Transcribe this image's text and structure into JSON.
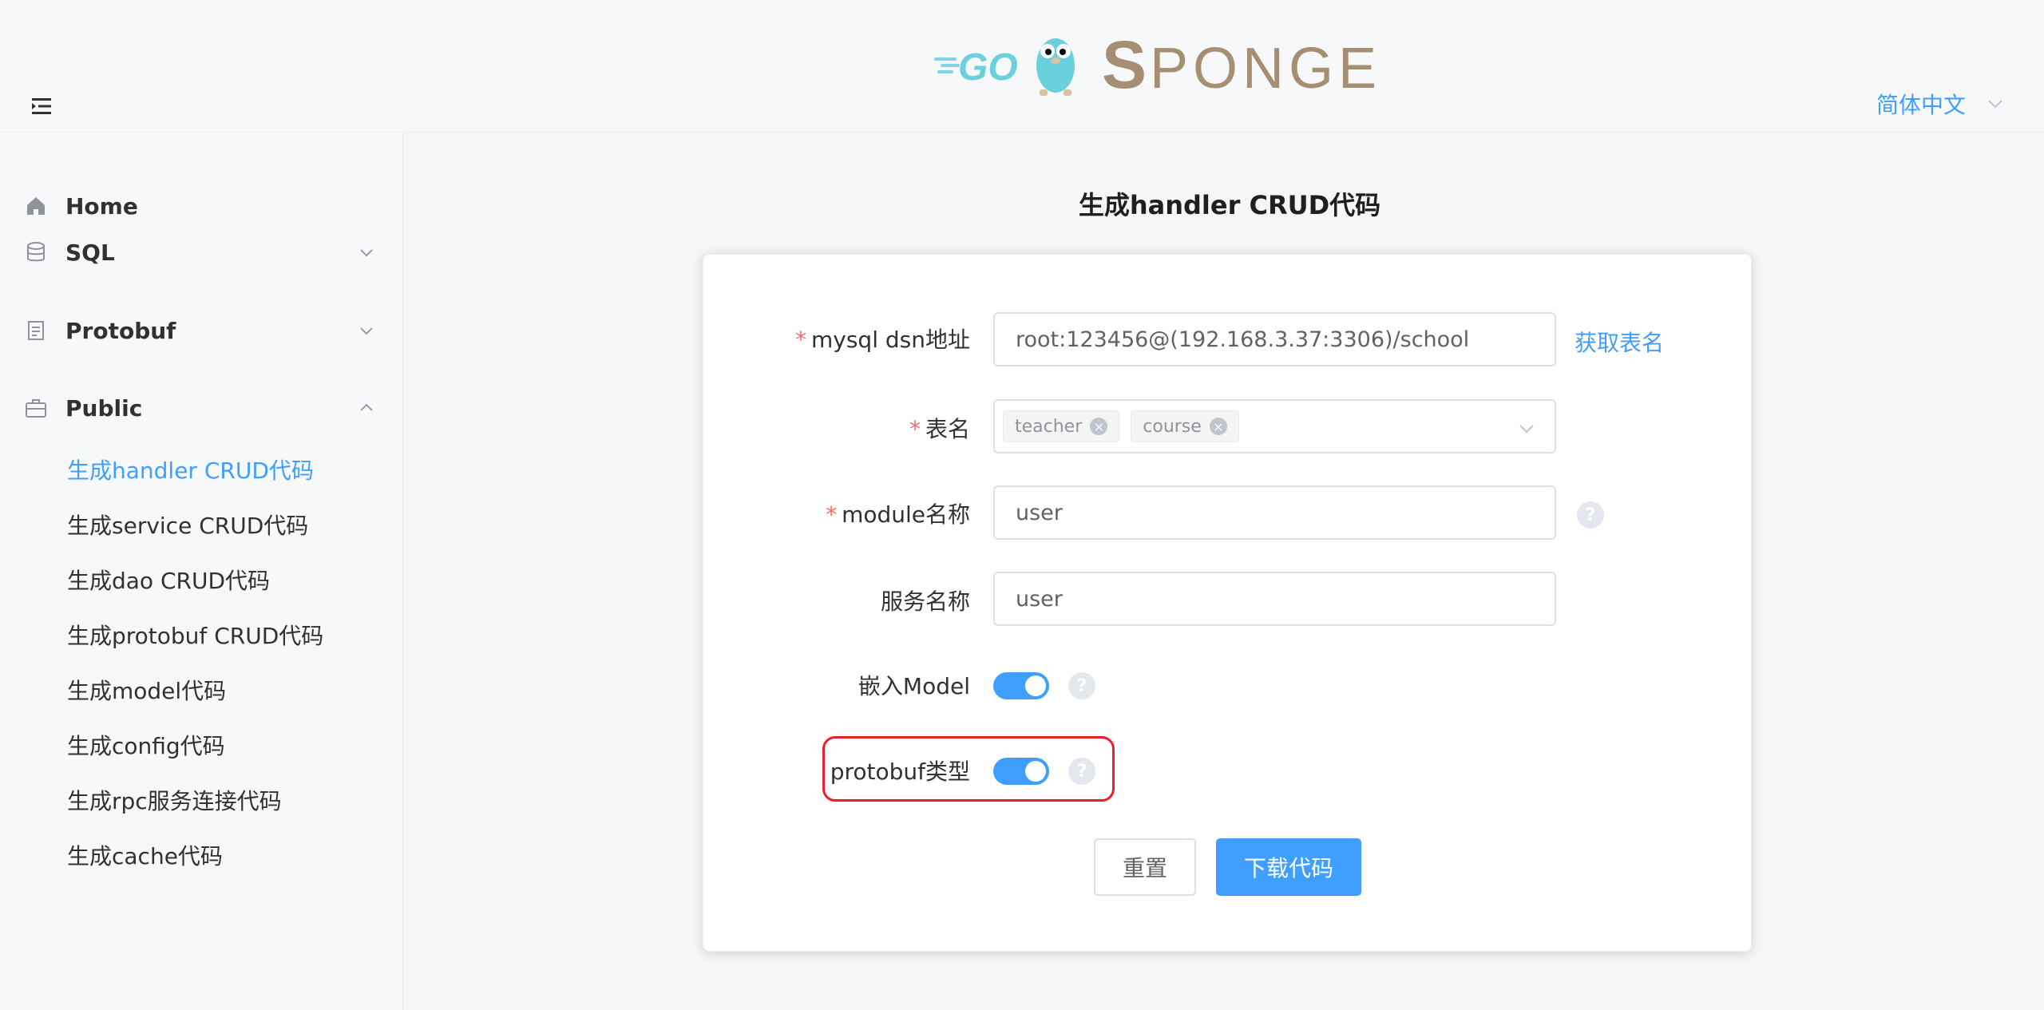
{
  "header": {
    "logo_text": "GO SPONGE",
    "language": "简体中文"
  },
  "sidebar": {
    "items": [
      {
        "label": "Home",
        "icon": "home-icon"
      },
      {
        "label": "SQL",
        "icon": "database-icon"
      },
      {
        "label": "Protobuf",
        "icon": "document-icon"
      },
      {
        "label": "Public",
        "icon": "briefcase-icon"
      }
    ],
    "subitems": [
      {
        "label": "生成handler CRUD代码",
        "active": true
      },
      {
        "label": "生成service CRUD代码"
      },
      {
        "label": "生成dao CRUD代码"
      },
      {
        "label": "生成protobuf CRUD代码"
      },
      {
        "label": "生成model代码"
      },
      {
        "label": "生成config代码"
      },
      {
        "label": "生成rpc服务连接代码"
      },
      {
        "label": "生成cache代码"
      }
    ]
  },
  "main": {
    "title": "生成handler CRUD代码",
    "form": {
      "dsn_label": "mysql dsn地址",
      "dsn_value": "root:123456@(192.168.3.37:3306)/school",
      "get_tables_link": "获取表名",
      "tables_label": "表名",
      "tables": [
        "teacher",
        "course"
      ],
      "module_label": "module名称",
      "module_value": "user",
      "service_label": "服务名称",
      "service_value": "user",
      "embed_label": "嵌入Model",
      "embed_on": true,
      "protobuf_label": "protobuf类型",
      "protobuf_on": true,
      "required_mark": "*",
      "help_mark": "?"
    },
    "buttons": {
      "reset": "重置",
      "download": "下载代码"
    }
  },
  "colors": {
    "accent": "#409eff",
    "required": "#f56c6c",
    "highlight": "#e8202a"
  }
}
